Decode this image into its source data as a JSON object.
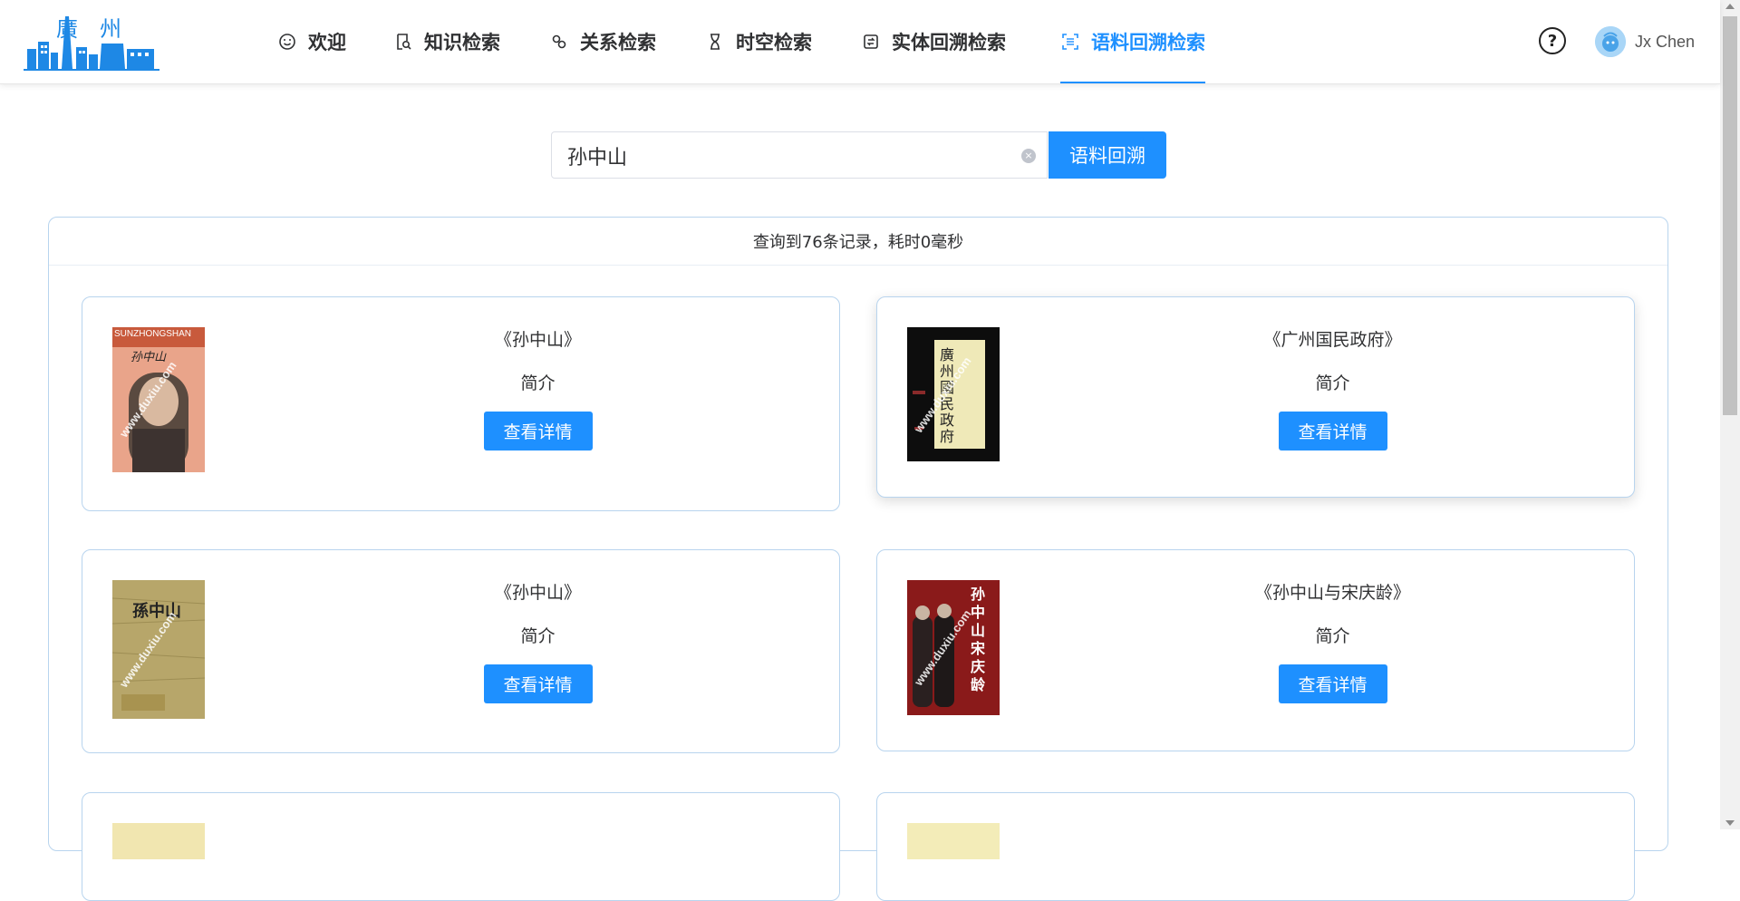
{
  "header": {
    "logo_text": "廣州",
    "nav": [
      {
        "label": "欢迎",
        "icon": "smile-icon"
      },
      {
        "label": "知识检索",
        "icon": "doc-search-icon"
      },
      {
        "label": "关系检索",
        "icon": "link-icon"
      },
      {
        "label": "时空检索",
        "icon": "hourglass-icon"
      },
      {
        "label": "实体回溯检索",
        "icon": "history-icon"
      },
      {
        "label": "语料回溯检索",
        "icon": "scan-icon",
        "active": true
      }
    ],
    "help_icon_label": "?",
    "user_name": "Jx Chen"
  },
  "search": {
    "value": "孙中山",
    "clear_label": "×",
    "button_label": "语料回溯"
  },
  "results": {
    "summary": "查询到76条记录，耗时0毫秒",
    "intro_label": "简介",
    "detail_label": "查看详情",
    "books": [
      {
        "title": "《孙中山》",
        "cover_text": "孙中山",
        "cover_top": "SUNZHONGSHAN"
      },
      {
        "title": "《广州国民政府》",
        "cover_text": "廣州國民政府"
      },
      {
        "title": "《孙中山》",
        "cover_text": "孫中山"
      },
      {
        "title": "《孙中山与宋庆龄》",
        "cover_text": "孙中山宋庆龄"
      }
    ],
    "watermark": "www.duxiu.com"
  },
  "colors": {
    "accent": "#1e90ff",
    "card_border": "#b8d4ee"
  }
}
